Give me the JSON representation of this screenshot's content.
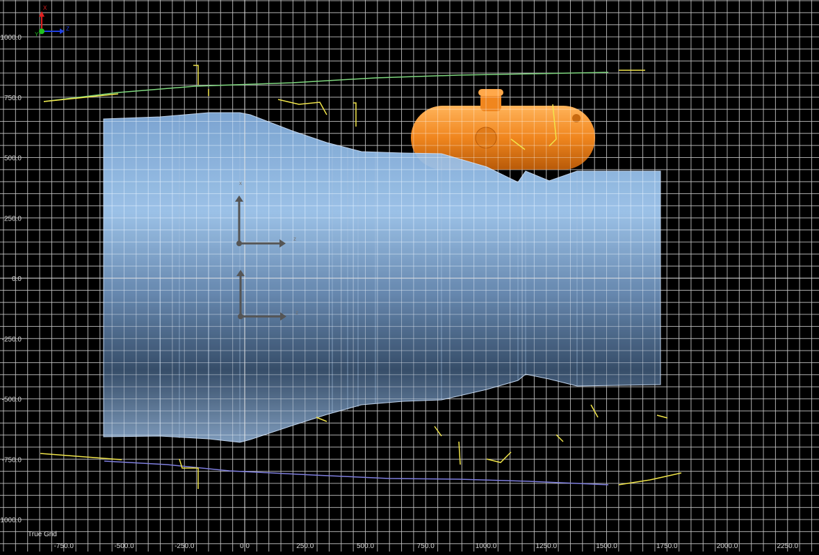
{
  "viewport": {
    "grid_title": "True Grid",
    "x_axis_labels": [
      "-750.0",
      "-500.0",
      "-250.0",
      "0.0",
      "250.0",
      "500.0",
      "750.0",
      "1000.0",
      "1250.0",
      "1500.0",
      "1750.0",
      "2000.0",
      "2250.0"
    ],
    "y_axis_labels": [
      "1000.0",
      "750.0",
      "500.0",
      "250.0",
      "0.0",
      "-250.0",
      "-500.0",
      "-750.0",
      "-1000.0"
    ],
    "colors": {
      "background": "#000000",
      "grid_line": "#6a6a6a",
      "axis_line": "#e6e6e6",
      "engine_body": "#8fb8e8",
      "tank": "#f0861e",
      "top_line": "#7fd87f",
      "bottom_line": "#7f7fe0",
      "edge_yellow": "#f2e64a"
    },
    "triad": {
      "x_label": "X",
      "y_label": "Y",
      "z_label": "Z"
    },
    "local_axes_label": "z",
    "local_axes_top_label": "x"
  }
}
